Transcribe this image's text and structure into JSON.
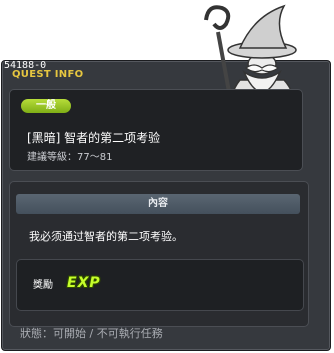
{
  "window": {
    "quest_id": "54188-0",
    "title": "QUEST INFO"
  },
  "quest": {
    "category": "一般",
    "name": "[黑暗] 智者的第二项考验",
    "level_label": "建議等級：",
    "level_range": "77～81"
  },
  "content": {
    "header": "內容",
    "description": "我必须通过智者的第二项考验。"
  },
  "reward": {
    "label": "獎勵",
    "exp_text": "EXP"
  },
  "status": {
    "text": "狀態：可開始 / 不可執行任務"
  },
  "colors": {
    "accent_title": "#e6c640",
    "badge_green": "#9ac828",
    "exp_green": "#c6ff2a",
    "panel_bg": "#36393e"
  },
  "icons": {
    "npc": "wizard-statue-icon",
    "reward": "exp-icon"
  }
}
